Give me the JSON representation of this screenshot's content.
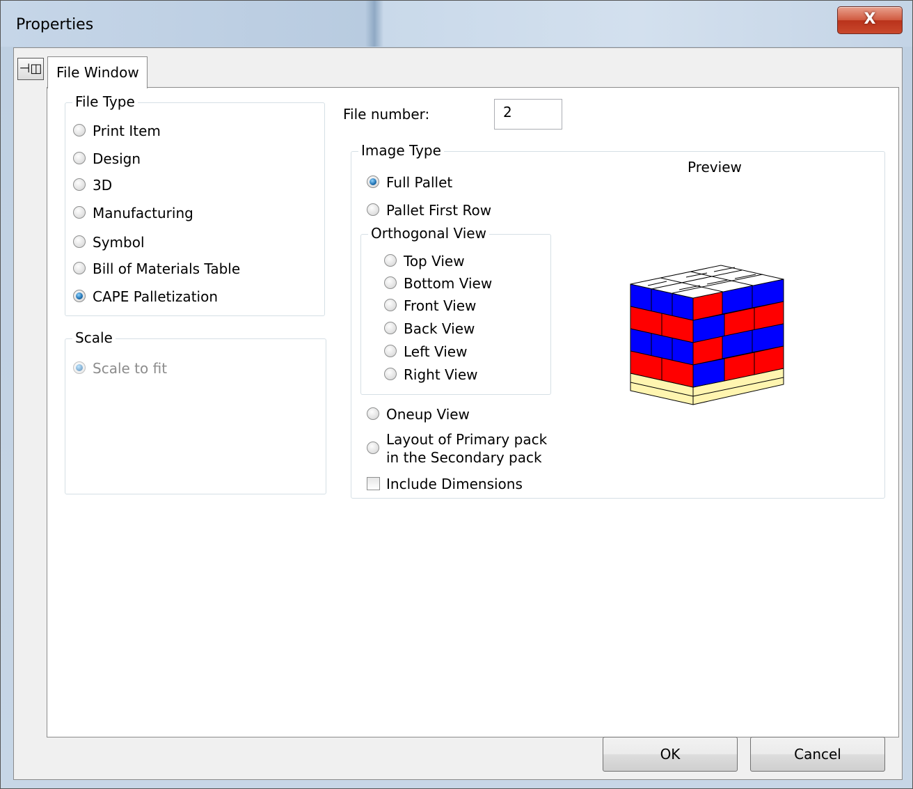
{
  "window": {
    "title": "Properties",
    "close_label": "X"
  },
  "pin": {
    "icon": "pin-icon",
    "glyph": "⊣◫"
  },
  "tabs": [
    {
      "label": "File Window"
    }
  ],
  "file_type": {
    "title": "File Type",
    "options": [
      {
        "label": "Print Item",
        "checked": false
      },
      {
        "label": "Design",
        "checked": false
      },
      {
        "label": "3D",
        "checked": false
      },
      {
        "label": "Manufacturing",
        "checked": false
      },
      {
        "label": "Symbol",
        "checked": false
      },
      {
        "label": "Bill of Materials Table",
        "checked": false
      },
      {
        "label": "CAPE Palletization",
        "checked": true
      }
    ]
  },
  "scale": {
    "title": "Scale",
    "options": [
      {
        "label": "Scale to fit",
        "checked": true,
        "disabled": true
      }
    ]
  },
  "file_number": {
    "label": "File number:",
    "value": "2"
  },
  "image_type": {
    "title": "Image Type",
    "options": [
      {
        "label": "Full Pallet",
        "checked": true
      },
      {
        "label": "Pallet First Row",
        "checked": false
      }
    ],
    "orthogonal": {
      "title": "Orthogonal View",
      "options": [
        {
          "label": "Top View"
        },
        {
          "label": "Bottom View"
        },
        {
          "label": "Front View"
        },
        {
          "label": "Back View"
        },
        {
          "label": "Left View"
        },
        {
          "label": "Right View"
        }
      ]
    },
    "oneup": "Oneup View",
    "layout_line1": "Layout of Primary pack",
    "layout_line2": "in the Secondary pack",
    "include_dimensions": "Include Dimensions",
    "preview_label": "Preview"
  },
  "buttons": {
    "ok": "OK",
    "cancel": "Cancel"
  },
  "colors": {
    "box_red": "#ff0000",
    "box_blue": "#0000ff",
    "pallet": "#fff5b0"
  }
}
